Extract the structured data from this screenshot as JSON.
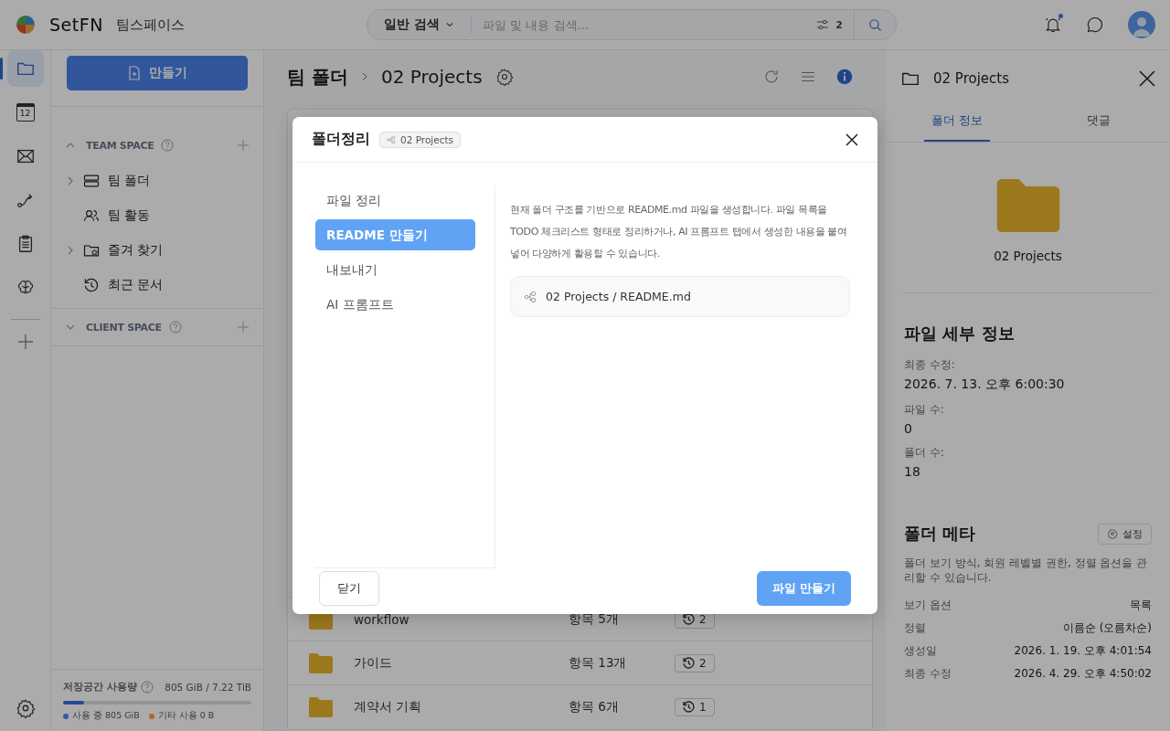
{
  "app": {
    "logo_text": "SetFN",
    "workspace": "팀스페이스"
  },
  "search": {
    "mode": "일반 검색",
    "placeholder": "파일 및 내용 검색...",
    "filter_count": "2"
  },
  "header_actions": {
    "notification_unread": true
  },
  "rail": [
    {
      "selected": true
    },
    {
      "label": "12",
      "selected": false
    },
    {
      "selected": false
    },
    {
      "selected": false
    },
    {
      "selected": false
    },
    {
      "selected": false
    }
  ],
  "sidebar": {
    "create_button": "만들기",
    "sections": [
      {
        "title": "TEAM SPACE",
        "expanded": true,
        "items": [
          {
            "label": "팀 폴더",
            "expandable": true
          },
          {
            "label": "팀 활동",
            "expandable": false
          },
          {
            "label": "즐겨 찾기",
            "expandable": true
          },
          {
            "label": "최근 문서",
            "expandable": false
          }
        ]
      },
      {
        "title": "CLIENT SPACE",
        "expanded": false
      }
    ]
  },
  "storage": {
    "label": "저장공간 사용량",
    "total": "805 GiB / 7.22 TiB",
    "level": 0.11,
    "legend": [
      {
        "label": "사용 중 805 GiB",
        "color": "#2d5ab4"
      },
      {
        "label": "기타 사용 0 B",
        "color": "#b0652a"
      }
    ]
  },
  "main": {
    "breadcrumb": [
      "팀 폴더",
      "02 Projects"
    ],
    "rows": [
      {
        "name": "workflow",
        "count": "항목 5개",
        "versions": "2"
      },
      {
        "name": "가이드",
        "count": "항목 13개",
        "versions": "2"
      },
      {
        "name": "계약서 기획",
        "count": "항목 6개",
        "versions": "1"
      }
    ]
  },
  "info_panel": {
    "title": "02 Projects",
    "tabs": [
      {
        "label": "폴더 정보",
        "selected": true
      },
      {
        "label": "댓글",
        "selected": false
      }
    ],
    "folder_name": "02 Projects",
    "details_title": "파일 세부 정보",
    "details": [
      {
        "label": "최종 수정:",
        "value": "2026. 7. 13. 오후 6:00:30"
      },
      {
        "label": "파일 수:",
        "value": "0"
      },
      {
        "label": "폴더 수:",
        "value": "18"
      }
    ],
    "meta_title": "폴더 메타",
    "settings_button": "설정",
    "meta_description": "폴더 보기 방식, 회원 레벨별 권한, 정렬 옵션을 관리할 수 있습니다.",
    "meta": [
      {
        "label": "보기 옵션",
        "value": "목록"
      },
      {
        "label": "정렬",
        "value": "이름순 (오름차순)"
      },
      {
        "label": "생성일",
        "value": "2026. 1. 19. 오후 4:01:54"
      },
      {
        "label": "최종 수정",
        "value": "2026. 4. 29. 오후 4:50:02"
      }
    ]
  },
  "dialog": {
    "title": "폴더정리",
    "path_chip": "02 Projects",
    "nav": [
      {
        "label": "파일 정리",
        "selected": false
      },
      {
        "label": "README 만들기",
        "selected": true
      },
      {
        "label": "내보내기",
        "selected": false
      },
      {
        "label": "AI 프롬프트",
        "selected": false
      }
    ],
    "description": "현재 폴더 구조를 기반으로 README.md 파일을 생성합니다. 파일 목록을 TODO 체크리스트 형태로 정리하거나, AI 프롬프트 탭에서 생성한 내용을 붙여넣어 다양하게 활용할 수 있습니다.",
    "file_path": "02 Projects / README.md",
    "cancel_button": "닫기",
    "confirm_button": "파일 만들기"
  }
}
